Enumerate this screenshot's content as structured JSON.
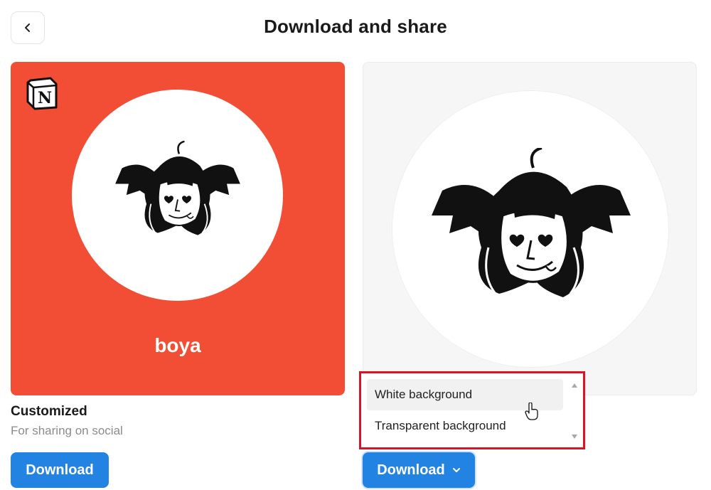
{
  "header": {
    "title": "Download and share",
    "back_icon": "chevron-left-icon"
  },
  "cards": {
    "custom": {
      "bg_color": "#f24d35",
      "logo_icon": "notion-logo",
      "name": "boya"
    },
    "plain": {
      "bg_color": "#f6f6f6"
    }
  },
  "options": {
    "custom": {
      "title": "Customized",
      "subtitle": "For sharing on social",
      "download_label": "Download"
    },
    "plain": {
      "download_label": "Download",
      "dropdown_icon": "chevron-down-icon"
    }
  },
  "dropdown": {
    "items": [
      "White background",
      "Transparent background"
    ],
    "hovered_index": 0,
    "highlight_color": "#d9142a"
  },
  "accent": "#2383e2"
}
